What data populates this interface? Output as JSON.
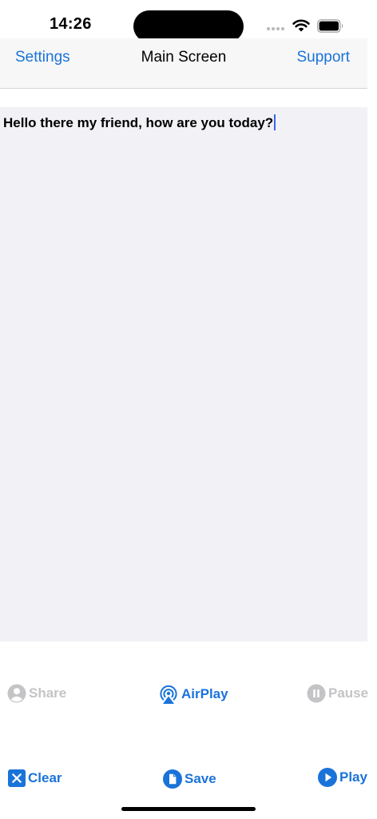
{
  "status_bar": {
    "time": "14:26",
    "icons": [
      "signal-icon",
      "wifi-icon",
      "battery-icon"
    ]
  },
  "nav": {
    "left_label": "Settings",
    "title": "Main Screen",
    "right_label": "Support"
  },
  "editor": {
    "text": "Hello there my friend, how are you today?"
  },
  "controls": {
    "share_label": "Share",
    "airplay_label": "AirPlay",
    "pause_label": "Pause",
    "clear_label": "Clear",
    "save_label": "Save",
    "play_label": "Play"
  },
  "colors": {
    "accent": "#1a73d9",
    "disabled": "#c4c4c7",
    "editor_background": "#f1f1f6",
    "nav_background": "#f7f7f7"
  }
}
